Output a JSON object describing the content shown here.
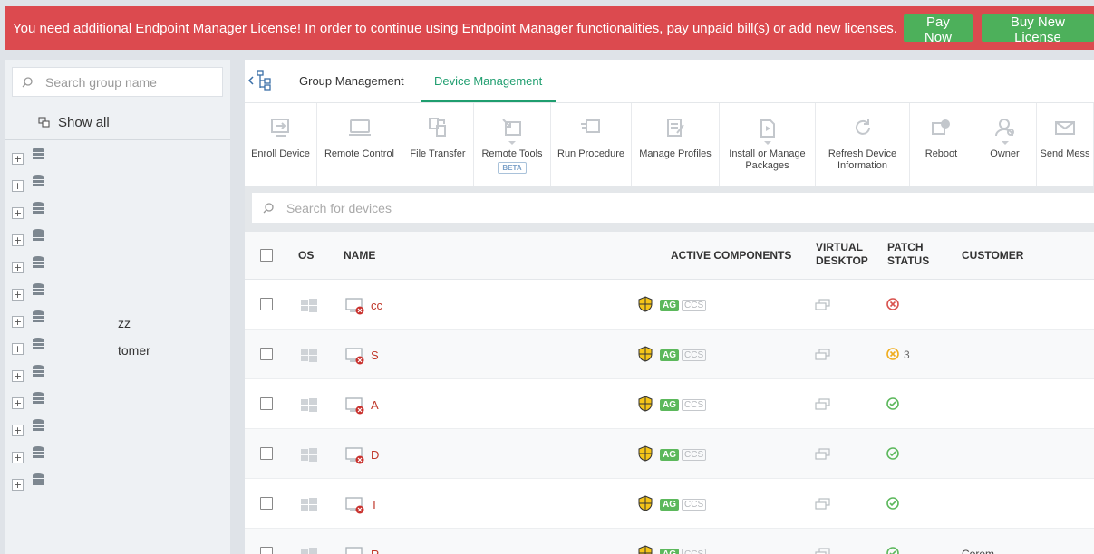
{
  "banner": {
    "message": "You need additional Endpoint Manager License! In order to continue using Endpoint Manager functionalities, pay unpaid bill(s) or add new licenses.",
    "pay_now": "Pay Now",
    "buy_license": "Buy New License",
    "bg_color": "#dc4a4f",
    "button_color": "#4db05b"
  },
  "sidebar": {
    "search_placeholder": "Search group name",
    "show_all": "Show all",
    "groups": [
      "",
      "",
      "",
      "",
      "",
      "",
      "zz",
      "tomer",
      "",
      "",
      "",
      "",
      ""
    ]
  },
  "tabs": {
    "group_management": "Group Management",
    "device_management": "Device Management",
    "active_color": "#1f9e6f"
  },
  "toolbar": [
    {
      "label": "Enroll Device",
      "icon": "enroll-device-icon"
    },
    {
      "label": "Remote Control",
      "icon": "monitor-icon"
    },
    {
      "label": "File Transfer",
      "icon": "file-transfer-icon"
    },
    {
      "label": "Remote Tools",
      "icon": "remote-tools-icon",
      "badge": "BETA",
      "dropdown": true
    },
    {
      "label": "Run Procedure",
      "icon": "run-procedure-icon"
    },
    {
      "label": "Manage Profiles",
      "icon": "profile-icon"
    },
    {
      "label": "Install or Manage Packages",
      "icon": "package-icon",
      "dropdown": true
    },
    {
      "label": "Refresh Device Information",
      "icon": "refresh-icon"
    },
    {
      "label": "Reboot",
      "icon": "reboot-icon"
    },
    {
      "label": "Owner",
      "icon": "owner-icon",
      "dropdown": true
    },
    {
      "label": "Send Mess",
      "icon": "mail-icon"
    }
  ],
  "device_search_placeholder": "Search for devices",
  "table": {
    "headers": {
      "os": "OS",
      "name": "NAME",
      "active_components": "ACTIVE COMPONENTS",
      "virtual_desktop_1": "VIRTUAL",
      "virtual_desktop_2": "DESKTOP",
      "patch_status_1": "PATCH",
      "patch_status_2": "STATUS",
      "customer": "CUSTOMER"
    },
    "rows": [
      {
        "name": "cc",
        "ag": "AG",
        "ccs": "CCS",
        "patch": "error",
        "extra": "",
        "customer": ""
      },
      {
        "name": "S",
        "ag": "AG",
        "ccs": "CCS",
        "patch": "warning",
        "extra": "3",
        "customer": ""
      },
      {
        "name": "A",
        "ag": "AG",
        "ccs": "CCS",
        "patch": "ok",
        "extra": "",
        "customer": ""
      },
      {
        "name": "D",
        "ag": "AG",
        "ccs": "CCS",
        "patch": "ok",
        "extra": "",
        "customer": ""
      },
      {
        "name": "T",
        "ag": "AG",
        "ccs": "CCS",
        "patch": "ok",
        "extra": "",
        "customer": ""
      },
      {
        "name": "R",
        "ag": "AG",
        "ccs": "CCS",
        "patch": "ok",
        "extra": "",
        "customer": "Corem"
      }
    ]
  }
}
